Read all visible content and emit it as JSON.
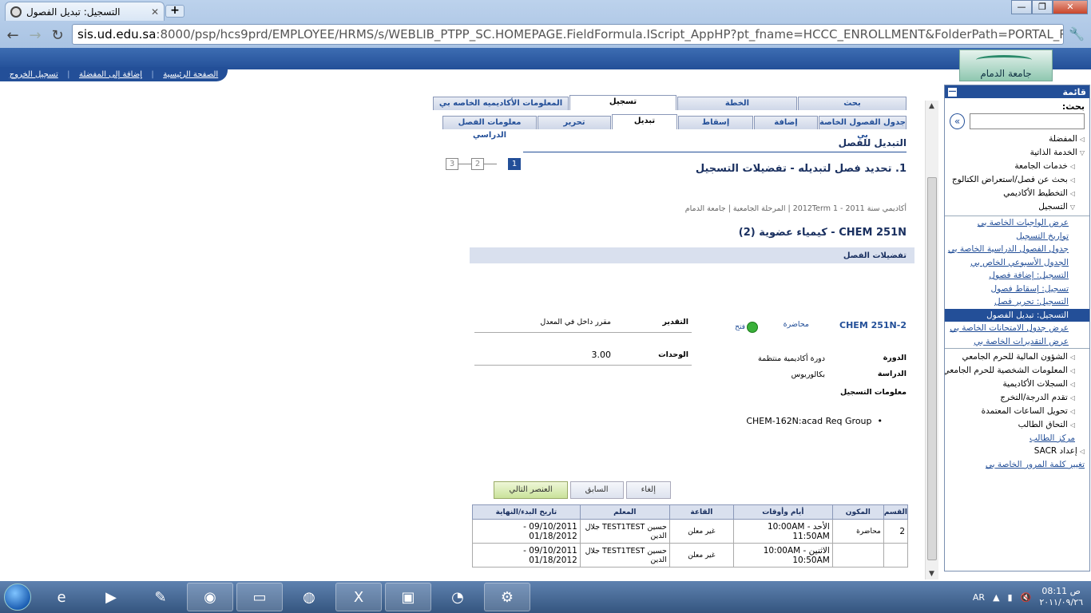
{
  "browser": {
    "tab_title": "التسجيل: تبديل الفصول",
    "url_host": "sis.ud.edu.sa",
    "url_rest": ":8000/psp/hcs9prd/EMPLOYEE/HRMS/s/WEBLIB_PTPP_SC.HOMEPAGE.FieldFormula.IScript_AppHP?pt_fname=HCCC_ENROLLMENT&FolderPath=PORTAL_ROOT_OBJECT"
  },
  "header": {
    "links": [
      "تسجيل الخروج",
      "إضافة إلى المفضلة",
      "الصفحة الرئيسية"
    ],
    "logo_text": "جامعة الدمام"
  },
  "sidebar": {
    "title": "قائمة",
    "search_label": "بحث:",
    "items": [
      {
        "label": "المفضلة",
        "level": 1
      },
      {
        "label": "الخدمة الذاتية",
        "level": 1
      },
      {
        "label": "خدمات الجامعة",
        "level": 2
      },
      {
        "label": "بحث عن فصل/استعراض الكتالوج",
        "level": 2
      },
      {
        "label": "التخطيط الأكاديمي",
        "level": 2
      },
      {
        "label": "التسجيل",
        "level": 2
      }
    ],
    "sub_items": [
      "عرض الواجبات الخاصة بي",
      "تواريخ التسجيل",
      "جدول الفصول الدراسية الخاصة بي",
      "الجدول الأسبوعي الخاص بي",
      "التسجيل: إضافة فصول",
      "تسجيل: إسقاط فصول",
      "التسجيل: تحرير فصل",
      "التسجيل: تبديل الفصول",
      "عرض جدول الامتحانات الخاصة بي",
      "عرض التقديرات الخاصة بي"
    ],
    "items_after": [
      "الشؤون المالية للحرم الجامعي",
      "المعلومات الشخصية للحرم الجامعي",
      "السجلات الأكاديمية",
      "تقدم الدرجة/التخرج",
      "تحويل الساعات المعتمدة",
      "التحاق الطالب"
    ],
    "link_student_center": "مركز الطالب",
    "setup": "إعداد SACR",
    "change_password": "تغيير كلمة المرور الخاصة بي"
  },
  "tabs_row1": [
    "بحث",
    "الخطة",
    "تسجيل",
    "المعلومات الأكاديميه الخاصه بي"
  ],
  "tabs_row2": [
    "جدول الفصول الخاصة بي",
    "إضافة",
    "إسقاط",
    "تبديل",
    "تحرير",
    "معلومات الفصل الدراسي"
  ],
  "page": {
    "title": "التبديل للفصل",
    "step_title": "1. تحديد فصل لتبديله - تفضيلات التسجيل",
    "steps": [
      "1",
      "2",
      "3"
    ],
    "academic": "أكاديمي سنة 2011 - 2012Term 1 | المرحلة الجامعية | جامعة الدمام",
    "course": "CHEM  251N - كيمياء عضوية (2)",
    "prefs_bar": "تفضيلات الفصل",
    "section": "CHEM  251N-2",
    "component": "محاضرة",
    "status": "فتح",
    "grading_label": "التقدير",
    "grading_value": "مقرر داخل في المعدل",
    "units_label": "الوحدات",
    "units_value": "3.00",
    "session_label": "الدورة",
    "session_value": "دورة أكاديمية منتظمة",
    "career_label": "الدراسة",
    "career_value": "بكالوريوس",
    "enroll_info_label": "معلومات التسجيل",
    "req_group": "CHEM-162N:acad Req Group"
  },
  "buttons": {
    "cancel": "إلغاء",
    "previous": "السابق",
    "next": "العنصر التالي"
  },
  "table": {
    "headers": [
      "القسم",
      "المكون",
      "أيام وأوقات",
      "القاعة",
      "المعلم",
      "تاريخ البدء/النهاية"
    ],
    "rows": [
      {
        "section": "2",
        "component": "محاضرة",
        "days": "الأحد - 10:00AM 11:50AM",
        "room": "غير معلن",
        "instructor": "حسين TEST1TEST جلال الدين",
        "dates": "09/10/2011 - 01/18/2012"
      },
      {
        "section": "",
        "component": "",
        "days": "الاثنين - 10:00AM 10:50AM",
        "room": "غير معلن",
        "instructor": "حسين TEST1TEST جلال الدين",
        "dates": "09/10/2011 - 01/18/2012"
      }
    ]
  },
  "taskbar": {
    "lang": "AR",
    "time": "08:11 ص",
    "date": "٢٠١١/٠٩/٢٦"
  }
}
